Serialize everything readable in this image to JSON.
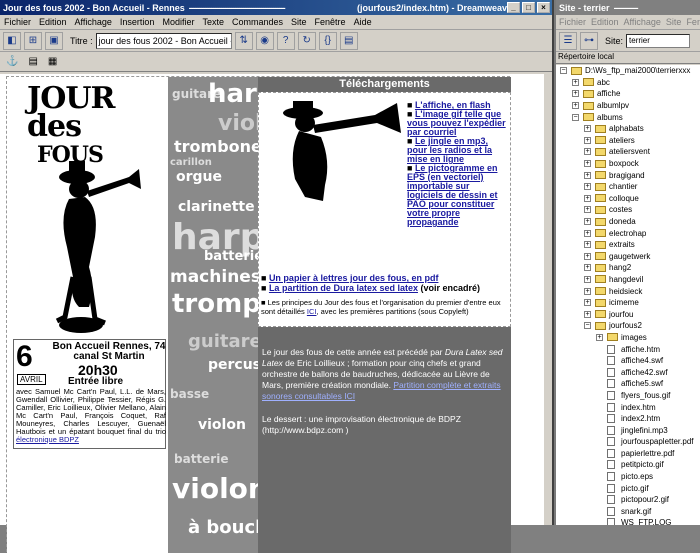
{
  "main_window": {
    "title": "Jour des fous 2002 - Bon Accueil - Rennes",
    "title_path": "(jourfous2/index.htm) - Dreamweaver",
    "menu": [
      "Fichier",
      "Edition",
      "Affichage",
      "Insertion",
      "Modifier",
      "Texte",
      "Commandes",
      "Site",
      "Fenêtre",
      "Aide"
    ],
    "title_label": "Titre :",
    "title_value": "jour des fous 2002 - Bon Accueil -"
  },
  "page": {
    "logo_line1": "JOUR des",
    "logo_line2": "FOUS",
    "day": "6",
    "month": "AVRIL",
    "venue": "Bon Accueil Rennes, 74 canal St Martin",
    "time": "20h30",
    "entry": "Entrée libre",
    "details": "avec Samuel Mc Cart'n Paul, L.L. de Mars, Gwendall Ollivier, Philippe Tessier, Régis G. Camiller, Eric Loillieux, Olivier Mellano, Alain Mc Cart'n Paul, François Coquet, Raf Mouneyres, Charles Lescuyer, Guenaël Hautbois et un épatant bouquet final du trio",
    "details_link": "électronique BDPZ",
    "strip_words": [
      "guitare",
      "harpe",
      "violon",
      "trombone",
      "carillon",
      "orgue",
      "clarinette",
      "harpe",
      "batterie",
      "machines",
      "trompette",
      "guitare",
      "percussion",
      "basse",
      "violon",
      "batterie",
      "violon",
      "à bouche"
    ],
    "downloads_title": "Téléchargements",
    "links": [
      "L'affiche, en flash",
      "L'image gif telle que vous pouvez l'expédier par courriel",
      "Le jingle en mp3, pour les radios et la mise en ligne",
      "Le pictogramme en EPS (en vectoriel) importable sur logiciels de dessin et PAO pour constituer votre propre propagande"
    ],
    "link_paper": "Un papier à lettres jour des fous, en pdf",
    "link_score": "La partition de Dura latex sed latex",
    "score_suffix": "(voir encadré)",
    "principles_text": "Les principes du Jour des fous et l'organisation du premier d'entre eux sont détaillés",
    "principles_link": "ICI",
    "principles_tail": ", avec les premières partitions (sous Copyleft)",
    "dura_intro": "Le jour des fous de cette année est précédé par",
    "dura_title": "Dura Latex sed Latex",
    "dura_text": "de Eric Loillieux ; formation pour cinq chefs et grand orchestre de ballons de baudruches, dédicacée au Lièvre de Mars, première création mondiale.",
    "dura_link": "Partition complète et extraits sonores consultables ICI",
    "dessert": "Le dessert : une improvisation électronique de BDPZ (http://www.bdpz.com )"
  },
  "site_window": {
    "title": "Site - terrier",
    "menu": [
      "Fichier",
      "Edition",
      "Affichage",
      "Site",
      "Fenêtre"
    ],
    "site_label": "Site:",
    "site_value": "terrier",
    "local_label": "Répertoire local",
    "root": "D:\\Ws_ftp_mai2000\\terrierxxx",
    "folders1": [
      "abc",
      "affiche",
      "albumlpv",
      "albums"
    ],
    "folders2": [
      "alphabats",
      "ateliers",
      "ateliersvent",
      "boxpock",
      "bragigand",
      "chantier",
      "colloque",
      "costes",
      "doneda",
      "electrohap",
      "extraits",
      "gaugetwerk",
      "hang2",
      "hangdevil",
      "heidsieck",
      "icimeme",
      "jourfou",
      "jourfous2"
    ],
    "files": [
      "images",
      "affiche.htm",
      "affiche4.swf",
      "affiche42.swf",
      "affiche5.swf",
      "flyers_fous.gif",
      "index.htm",
      "index2.htm",
      "jinglefini.mp3",
      "jourfouspapletter.pdf",
      "papierlettre.pdf",
      "petitpicto.gif",
      "picto.eps",
      "picto.gif",
      "pictopour2.gif",
      "snark.gif",
      "WS_FTP.LOG"
    ]
  }
}
